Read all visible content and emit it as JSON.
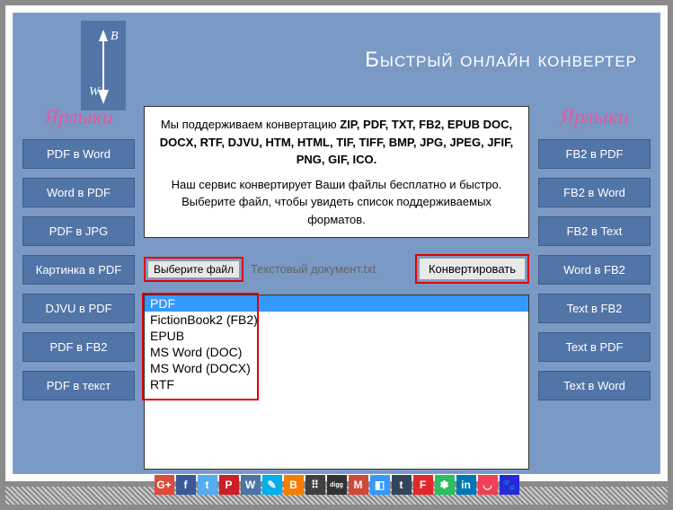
{
  "header": {
    "title": "Быстрый онлайн конвертер",
    "logo_top": "B",
    "logo_bottom": "W"
  },
  "info": {
    "line1_prefix": "Мы поддерживаем конвертацию ",
    "line1_bold": "ZIP, PDF, TXT, FB2, EPUB DOC, DOCX, RTF, DJVU, HTM, HTML, TIF, TIFF, BMP, JPG, JPEG, JFIF, PNG, GIF, ICO.",
    "line2": "Наш сервис конвертирует Ваши файлы бесплатно и быстро. Выберите файл, чтобы увидеть список поддерживаемых форматов."
  },
  "sidebars": {
    "title_left": "Ярлыки",
    "title_right": "Ярлыки",
    "left": [
      "PDF в Word",
      "Word в PDF",
      "PDF в JPG",
      "Картинка в PDF",
      "DJVU в PDF",
      "PDF в FB2",
      "PDF в текст"
    ],
    "right": [
      "FB2 в PDF",
      "FB2 в Word",
      "FB2 в Text",
      "Word в FB2",
      "Text в FB2",
      "Text в PDF",
      "Text в Word"
    ]
  },
  "controls": {
    "choose_file": "Выберите файл",
    "filename": "Текстовый документ.txt",
    "convert": "Конвертировать"
  },
  "formats": {
    "items": [
      "PDF",
      "FictionBook2 (FB2)",
      "EPUB",
      "MS Word (DOC)",
      "MS Word (DOCX)",
      "RTF"
    ],
    "selected": 0
  },
  "social": [
    {
      "name": "googleplus",
      "bg": "#dd4b39",
      "glyph": "G+"
    },
    {
      "name": "facebook",
      "bg": "#3b5998",
      "glyph": "f"
    },
    {
      "name": "twitter",
      "bg": "#55acee",
      "glyph": "t"
    },
    {
      "name": "pinterest",
      "bg": "#cb2027",
      "glyph": "P"
    },
    {
      "name": "vk",
      "bg": "#4c75a3",
      "glyph": "W"
    },
    {
      "name": "livejournal",
      "bg": "#00b0ea",
      "glyph": "✎"
    },
    {
      "name": "blogger",
      "bg": "#f57d00",
      "glyph": "B"
    },
    {
      "name": "myspace",
      "bg": "#404040",
      "glyph": "⠿"
    },
    {
      "name": "digg",
      "bg": "#333333",
      "glyph": "digg"
    },
    {
      "name": "gmail",
      "bg": "#d14836",
      "glyph": "M"
    },
    {
      "name": "delicious",
      "bg": "#3399ff",
      "glyph": "◧"
    },
    {
      "name": "tumblr",
      "bg": "#35465c",
      "glyph": "t"
    },
    {
      "name": "flipboard",
      "bg": "#e12828",
      "glyph": "F"
    },
    {
      "name": "evernote",
      "bg": "#2dbe60",
      "glyph": "❃"
    },
    {
      "name": "linkedin",
      "bg": "#0077b5",
      "glyph": "in"
    },
    {
      "name": "pocket",
      "bg": "#ef4056",
      "glyph": "◡"
    },
    {
      "name": "baidu",
      "bg": "#2529d8",
      "glyph": "🐾"
    }
  ]
}
